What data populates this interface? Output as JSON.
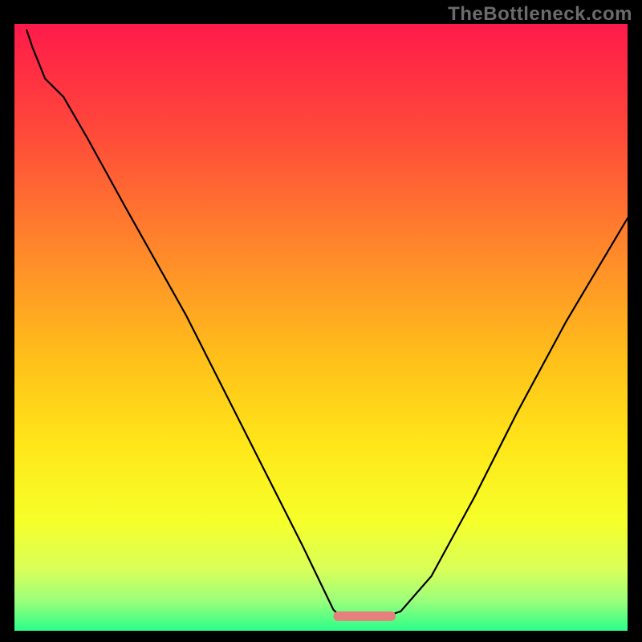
{
  "watermark": "TheBottleneck.com",
  "colors": {
    "bg": "#000000",
    "curve": "#000000",
    "accent": "#e77f7d",
    "watermark": "#6b6b6b",
    "gradient_stops": [
      {
        "offset": 0.0,
        "color": "#ff1a4a"
      },
      {
        "offset": 0.18,
        "color": "#ff4a3a"
      },
      {
        "offset": 0.38,
        "color": "#ff8a2a"
      },
      {
        "offset": 0.55,
        "color": "#ffbf1a"
      },
      {
        "offset": 0.7,
        "color": "#ffe81a"
      },
      {
        "offset": 0.82,
        "color": "#f6ff2a"
      },
      {
        "offset": 0.9,
        "color": "#d8ff5a"
      },
      {
        "offset": 0.95,
        "color": "#9cff7a"
      },
      {
        "offset": 1.0,
        "color": "#2aff8a"
      }
    ]
  },
  "chart_data": {
    "type": "line",
    "title": "",
    "xlabel": "",
    "ylabel": "",
    "xlim": [
      0,
      100
    ],
    "ylim": [
      0,
      100
    ],
    "series": [
      {
        "name": "left-arm",
        "x": [
          2,
          3,
          4,
          5,
          8,
          12,
          18,
          28,
          38,
          47,
          52,
          53
        ],
        "values": [
          99,
          96,
          93.5,
          91,
          88,
          81,
          70,
          52,
          32,
          14,
          3.5,
          2.5
        ]
      },
      {
        "name": "valley-floor",
        "x": [
          53,
          56,
          59,
          61
        ],
        "values": [
          2.5,
          2.3,
          2.3,
          2.5
        ]
      },
      {
        "name": "right-arm",
        "x": [
          61,
          63,
          68,
          75,
          82,
          90,
          100
        ],
        "values": [
          2.5,
          3.2,
          9,
          22,
          36,
          51,
          68
        ]
      }
    ],
    "accent_segment": {
      "name": "accent-bar",
      "x": [
        52.8,
        61.4
      ],
      "values": [
        2.4,
        2.4
      ]
    }
  }
}
